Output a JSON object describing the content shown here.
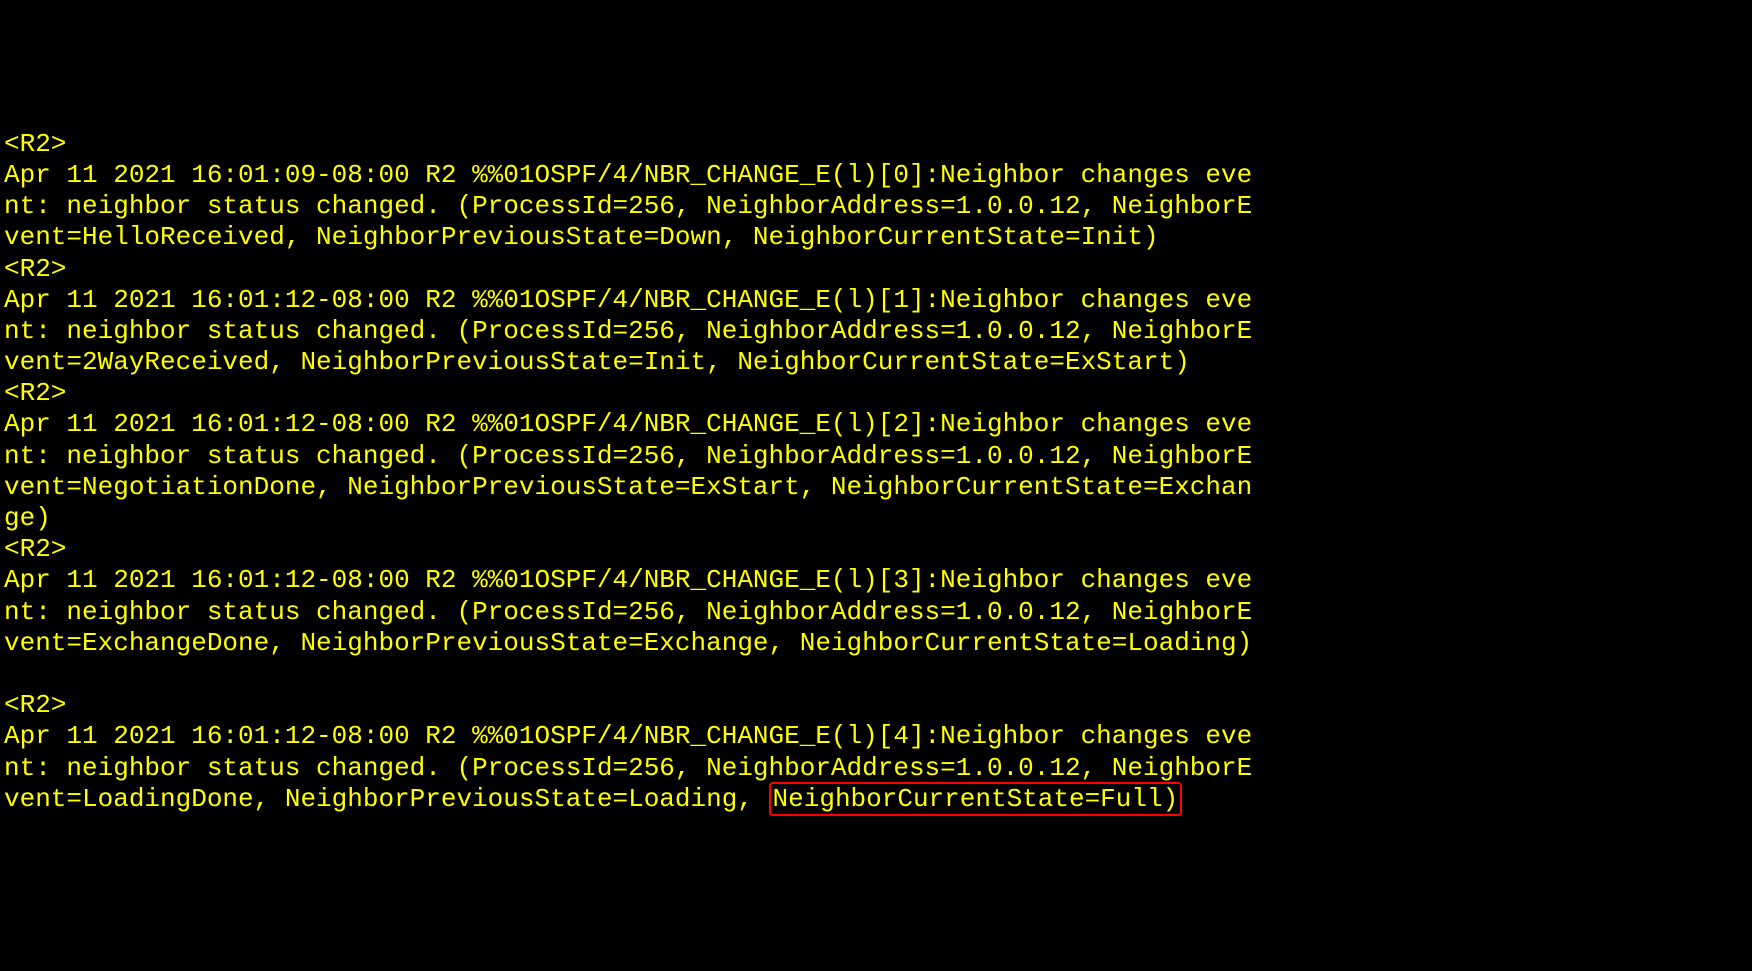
{
  "prompt": "<R2>",
  "entries": [
    {
      "l1": "Apr 11 2021 16:01:09-08:00 R2 %%01OSPF/4/NBR_CHANGE_E(l)[0]:Neighbor changes eve",
      "l2": "nt: neighbor status changed. (ProcessId=256, NeighborAddress=1.0.0.12, NeighborE",
      "l3": "vent=HelloReceived, NeighborPreviousState=Down, NeighborCurrentState=Init)"
    },
    {
      "l1": "Apr 11 2021 16:01:12-08:00 R2 %%01OSPF/4/NBR_CHANGE_E(l)[1]:Neighbor changes eve",
      "l2": "nt: neighbor status changed. (ProcessId=256, NeighborAddress=1.0.0.12, NeighborE",
      "l3": "vent=2WayReceived, NeighborPreviousState=Init, NeighborCurrentState=ExStart)"
    },
    {
      "l1": "Apr 11 2021 16:01:12-08:00 R2 %%01OSPF/4/NBR_CHANGE_E(l)[2]:Neighbor changes eve",
      "l2": "nt: neighbor status changed. (ProcessId=256, NeighborAddress=1.0.0.12, NeighborE",
      "l3": "vent=NegotiationDone, NeighborPreviousState=ExStart, NeighborCurrentState=Exchan",
      "l4": "ge)"
    },
    {
      "l1": "Apr 11 2021 16:01:12-08:00 R2 %%01OSPF/4/NBR_CHANGE_E(l)[3]:Neighbor changes eve",
      "l2": "nt: neighbor status changed. (ProcessId=256, NeighborAddress=1.0.0.12, NeighborE",
      "l3": "vent=ExchangeDone, NeighborPreviousState=Exchange, NeighborCurrentState=Loading)"
    },
    {
      "l1": "Apr 11 2021 16:01:12-08:00 R2 %%01OSPF/4/NBR_CHANGE_E(l)[4]:Neighbor changes eve",
      "l2": "nt: neighbor status changed. (ProcessId=256, NeighborAddress=1.0.0.12, NeighborE",
      "l3_prefix": "vent=LoadingDone, NeighborPreviousState=Loading, ",
      "l3_highlight": "NeighborCurrentState=Full)"
    }
  ]
}
